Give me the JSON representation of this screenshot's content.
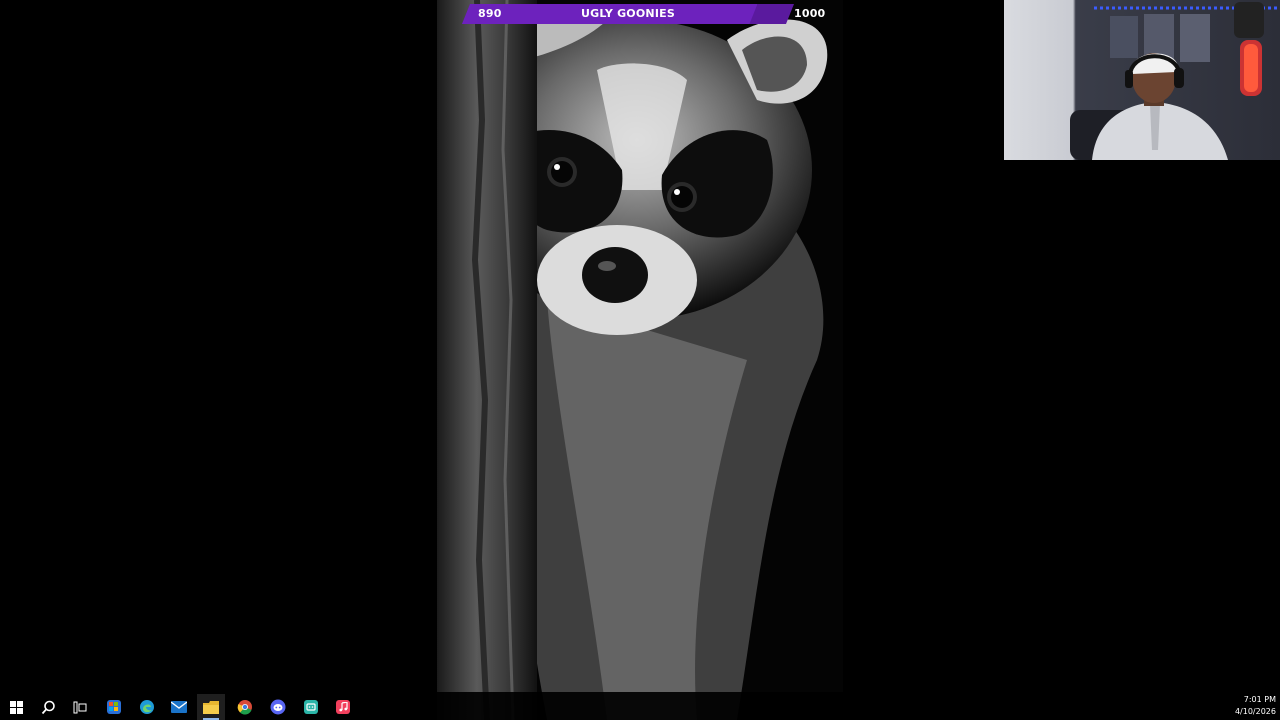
{
  "goal": {
    "current": "890",
    "title": "UGLY GOONIES",
    "target": "1000",
    "progress_fraction": 0.89,
    "color": "#6d22bd"
  },
  "wallpaper": {
    "subject": "raccoon-peeking-behind-tree"
  },
  "webcam": {
    "subject": "streamer-webcam"
  },
  "taskbar": {
    "items": [
      {
        "icon": "windows-start-icon"
      },
      {
        "icon": "search-icon"
      },
      {
        "icon": "task-view-icon"
      },
      {
        "icon": "microsoft-store-icon",
        "color": "#2a6fd6"
      },
      {
        "icon": "edge-icon",
        "color": "#1e9bd7"
      },
      {
        "icon": "mail-icon",
        "color": "#1a73c8"
      },
      {
        "icon": "file-explorer-icon",
        "color": "#e8b730",
        "active": true
      },
      {
        "icon": "chrome-icon",
        "color": "#d94a38"
      },
      {
        "icon": "discord-icon",
        "color": "#5865f2"
      },
      {
        "icon": "app-icon",
        "color": "#2bb5a8"
      },
      {
        "icon": "music-icon",
        "color": "#f2405d"
      }
    ]
  },
  "clock": {
    "time": "7:01 PM",
    "date": "4/10/2026"
  }
}
